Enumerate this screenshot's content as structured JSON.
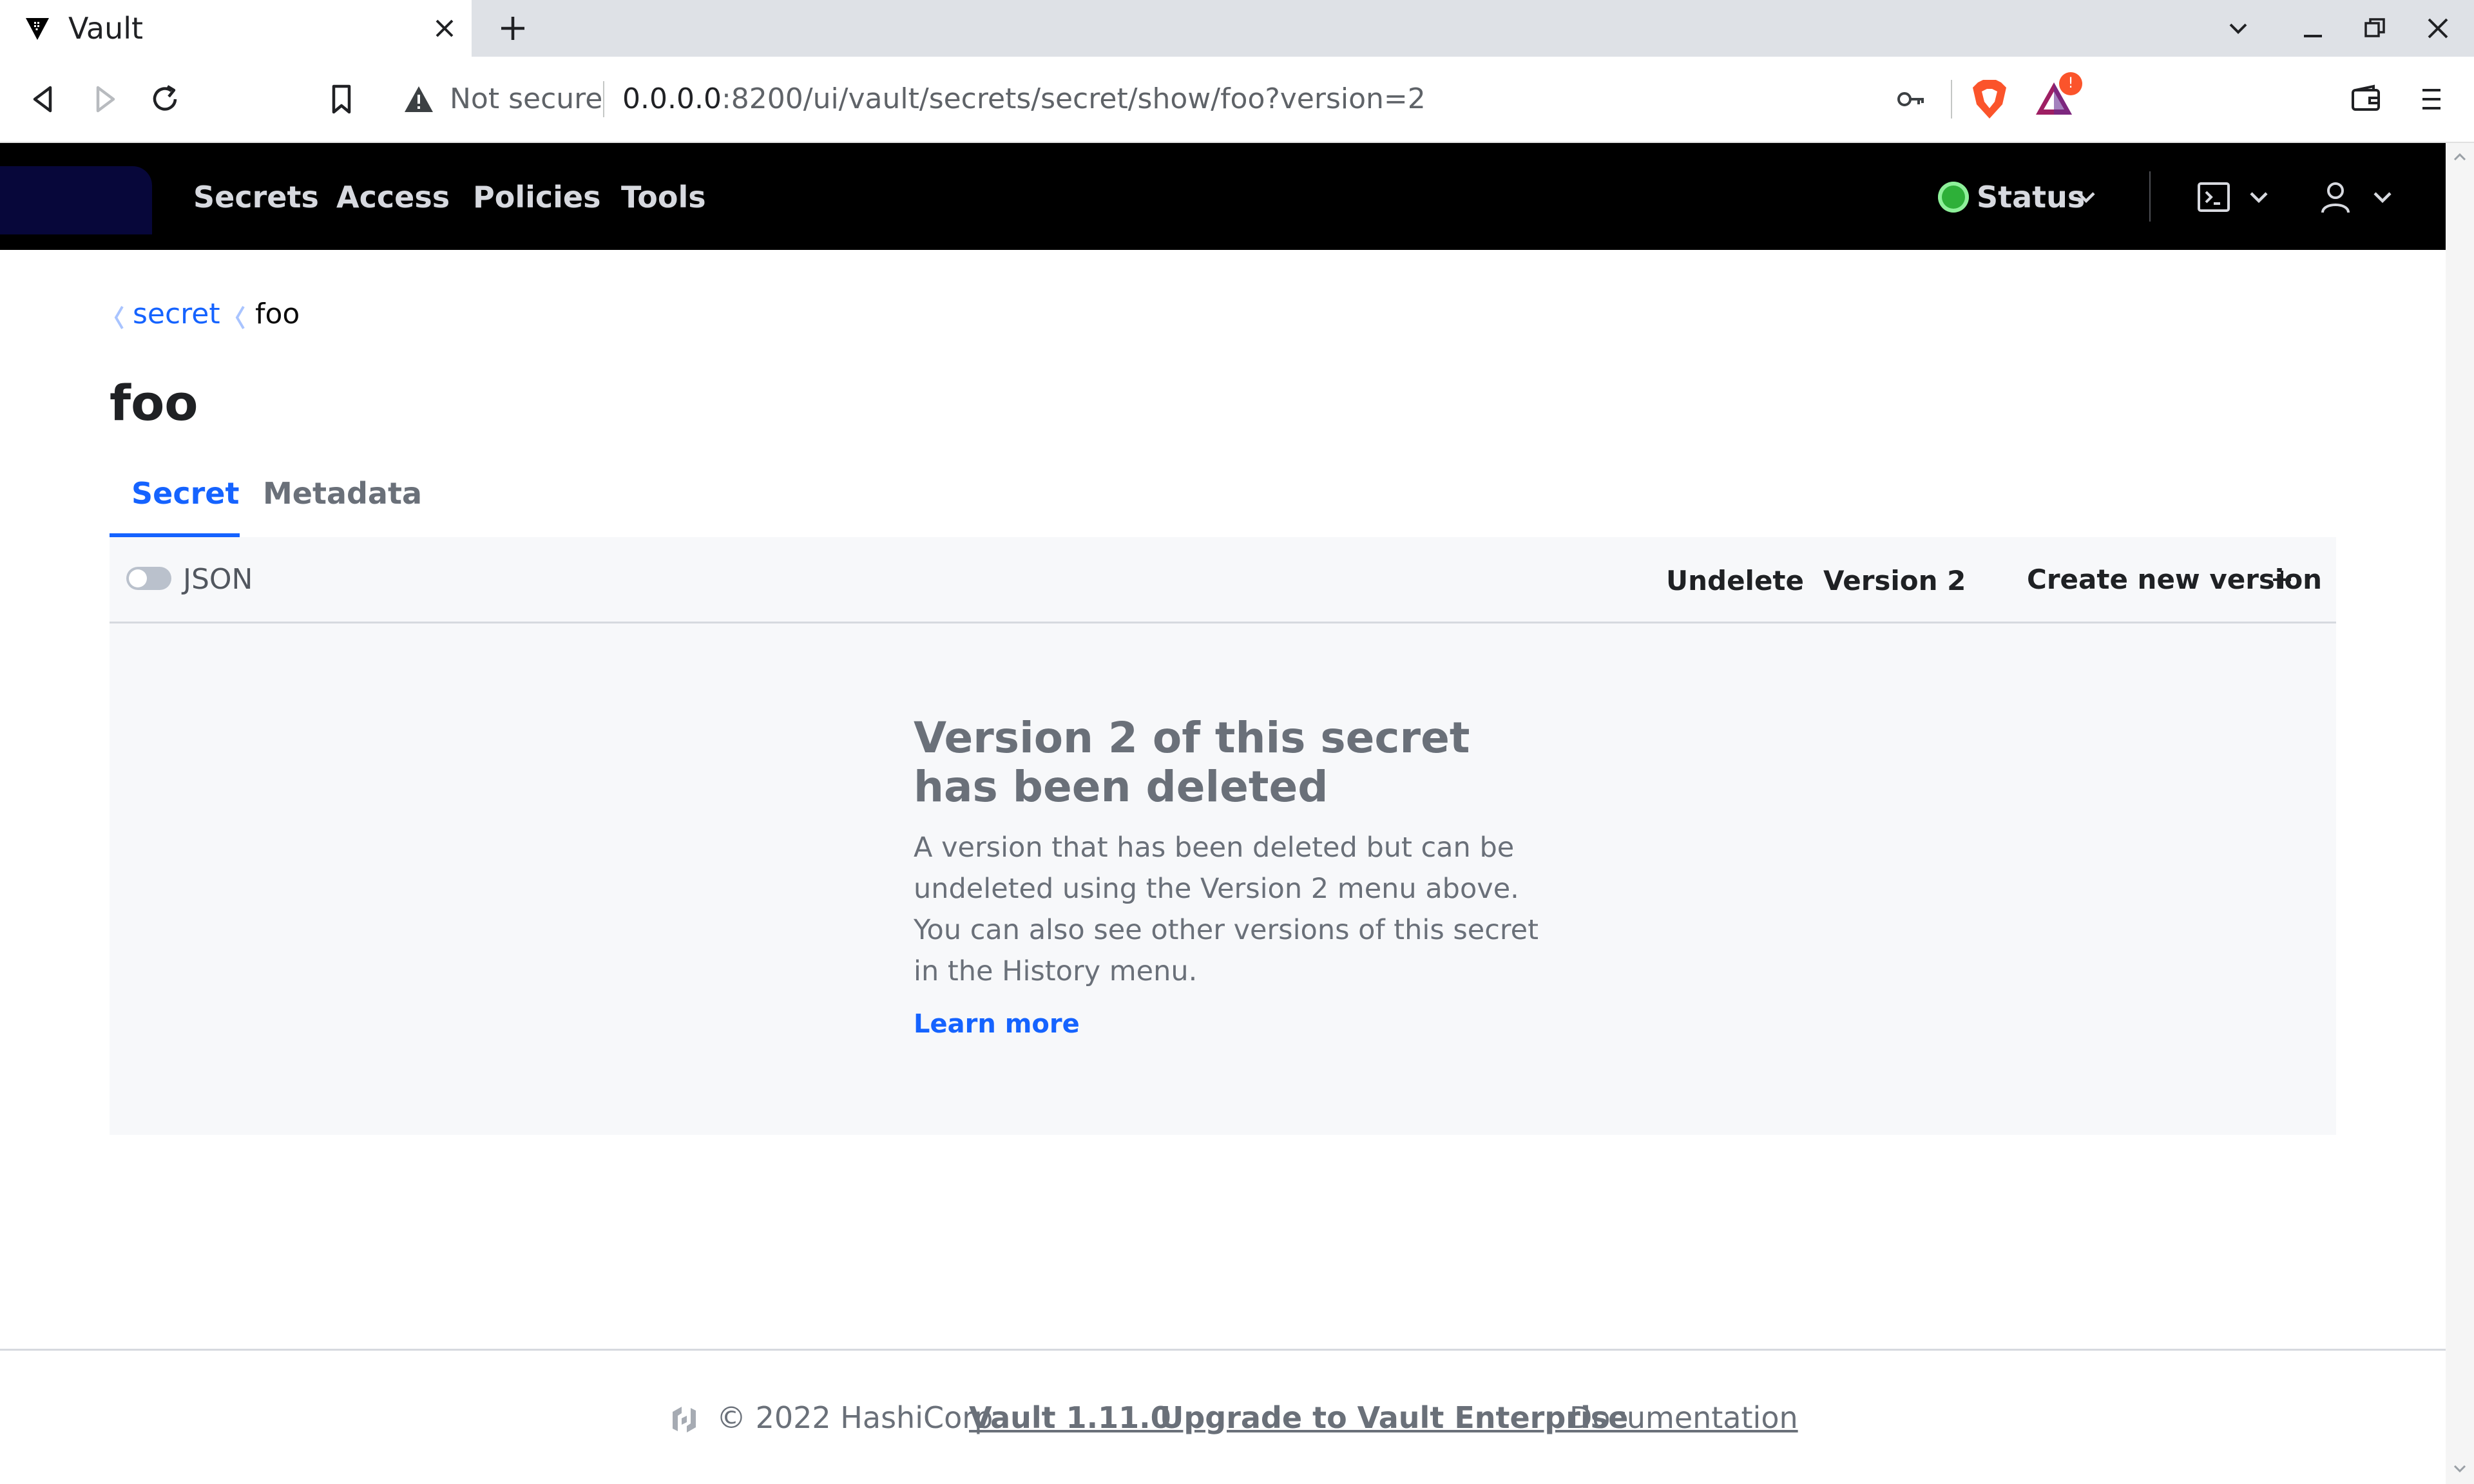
{
  "browser": {
    "tab_title": "Vault",
    "omnibox": {
      "security_label": "Not secure",
      "url_host": "0.0.0.0",
      "url_path": ":8200/ui/vault/secrets/secret/show/foo?version=2"
    },
    "rewards_badge_count": "!"
  },
  "vault_nav": {
    "links": [
      "Secrets",
      "Access",
      "Policies",
      "Tools"
    ],
    "status_label": "Status",
    "status_color": "#2eb039"
  },
  "breadcrumb": {
    "parent": "secret",
    "current": "foo"
  },
  "page": {
    "title": "foo",
    "tabs": [
      {
        "label": "Secret",
        "active": true
      },
      {
        "label": "Metadata",
        "active": false
      }
    ]
  },
  "secret_toolbar": {
    "json_toggle_label": "JSON",
    "json_toggle_on": false,
    "undelete_label": "Undelete",
    "version_label": "Version 2",
    "create_version_label": "Create new version"
  },
  "empty_state": {
    "title": "Version 2 of this secret has been deleted",
    "message": "A version that has been deleted but can be undeleted using the Version 2 menu above. You can also see other versions of this secret in the History menu.",
    "link_label": "Learn more"
  },
  "footer": {
    "copyright": "© 2022 HashiCorp",
    "version_link": "Vault 1.11.0",
    "upgrade_link": "Upgrade to Vault Enterprise",
    "docs_link": "Documentation"
  },
  "colors": {
    "accent_blue": "#1563ff",
    "nav_background": "#000000",
    "panel_background": "#f7f8fa"
  }
}
